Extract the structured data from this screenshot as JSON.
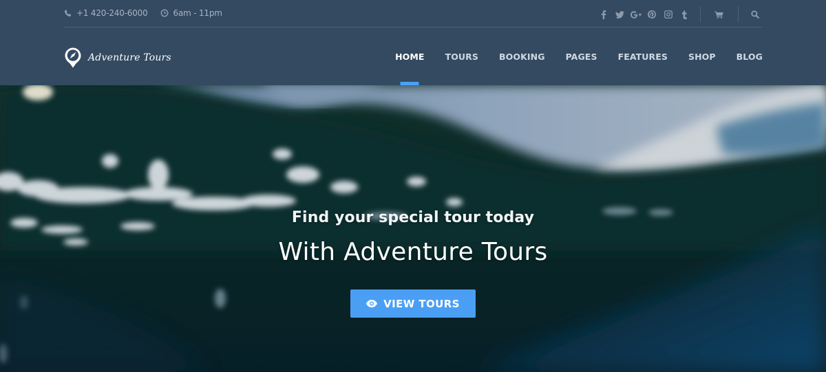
{
  "brand": {
    "name": "Adventure Tours",
    "accent_color": "#4a9ff5",
    "header_bg": "#334a61"
  },
  "topbar": {
    "phone": "+1 420-240-6000",
    "hours": "6am - 11pm",
    "social": [
      {
        "name": "facebook",
        "icon": "facebook-icon"
      },
      {
        "name": "twitter",
        "icon": "twitter-icon"
      },
      {
        "name": "google-plus",
        "icon": "google-plus-icon"
      },
      {
        "name": "pinterest",
        "icon": "pinterest-icon"
      },
      {
        "name": "instagram",
        "icon": "instagram-icon"
      },
      {
        "name": "tumblr",
        "icon": "tumblr-icon"
      }
    ],
    "cart_icon": "cart-icon",
    "search_icon": "search-icon"
  },
  "nav": {
    "items": [
      {
        "label": "HOME",
        "active": true
      },
      {
        "label": "TOURS",
        "active": false
      },
      {
        "label": "BOOKING",
        "active": false
      },
      {
        "label": "PAGES",
        "active": false
      },
      {
        "label": "FEATURES",
        "active": false
      },
      {
        "label": "SHOP",
        "active": false
      },
      {
        "label": "BLOG",
        "active": false
      }
    ]
  },
  "hero": {
    "subtitle": "Find your special tour today",
    "title": "With Adventure Tours",
    "cta_label": "VIEW TOURS",
    "cta_icon": "eye-icon"
  }
}
